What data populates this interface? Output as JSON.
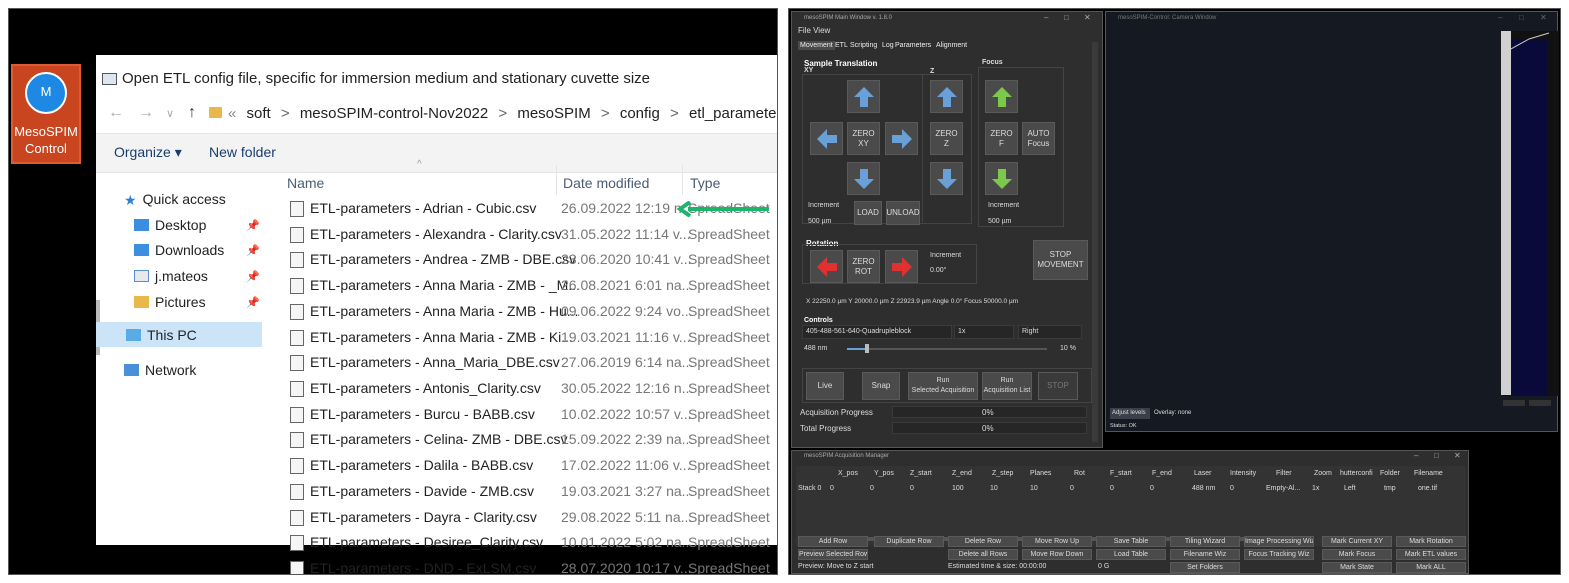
{
  "desktop_icon": {
    "letter": "M",
    "line1": "MesoSPIM",
    "line2": "Control"
  },
  "dialog": {
    "title": "Open ETL config file, specific for immersion medium and stationary cuvette size",
    "breadcrumb": [
      "«",
      "soft",
      ">",
      "mesoSPIM-control-Nov2022",
      ">",
      "mesoSPIM",
      ">",
      "config",
      ">",
      "etl_parameters"
    ],
    "organize": "Organize ▾",
    "new_folder": "New folder",
    "sidebar": {
      "quick_access": "Quick access",
      "items": [
        "Desktop",
        "Downloads",
        "j.mateos",
        "Pictures"
      ],
      "this_pc": "This PC",
      "network": "Network"
    },
    "columns": {
      "name": "Name",
      "date": "Date modified",
      "type": "Type"
    },
    "files": [
      {
        "name": "ETL-parameters - Adrian - Cubic.csv",
        "date": "26.09.2022 12:19 n...",
        "type": "SpreadSheet"
      },
      {
        "name": "ETL-parameters - Alexandra - Clarity.csv",
        "date": "31.05.2022 11:14 v...",
        "type": "SpreadSheet"
      },
      {
        "name": "ETL-parameters - Andrea - ZMB - DBE.csv",
        "date": "23.06.2020 10:41 v...",
        "type": "SpreadSheet"
      },
      {
        "name": "ETL-parameters - Anna Maria - ZMB - _M...",
        "date": "26.08.2021 6:01 na...",
        "type": "SpreadSheet"
      },
      {
        "name": "ETL-parameters - Anna Maria - ZMB - Hu...",
        "date": "09.06.2022 9:24 vo...",
        "type": "SpreadSheet"
      },
      {
        "name": "ETL-parameters - Anna Maria - ZMB - Ki...",
        "date": "19.03.2021 11:16 v...",
        "type": "SpreadSheet"
      },
      {
        "name": "ETL-parameters - Anna_Maria_DBE.csv",
        "date": "27.06.2019 6:14 na...",
        "type": "SpreadSheet"
      },
      {
        "name": "ETL-parameters - Antonis_Clarity.csv",
        "date": "30.05.2022 12:16 n...",
        "type": "SpreadSheet"
      },
      {
        "name": "ETL-parameters - Burcu - BABB.csv",
        "date": "10.02.2022 10:57 v...",
        "type": "SpreadSheet"
      },
      {
        "name": "ETL-parameters - Celina- ZMB - DBE.csv",
        "date": "15.09.2022 2:39 na...",
        "type": "SpreadSheet"
      },
      {
        "name": "ETL-parameters - Dalila - BABB.csv",
        "date": "17.02.2022 11:06 v...",
        "type": "SpreadSheet"
      },
      {
        "name": "ETL-parameters - Davide - ZMB.csv",
        "date": "19.03.2021 3:27 na...",
        "type": "SpreadSheet"
      },
      {
        "name": "ETL-parameters - Dayra - Clarity.csv",
        "date": "29.08.2022 5:11 na...",
        "type": "SpreadSheet"
      },
      {
        "name": "ETL-parameters - Desiree_Clarity.csv",
        "date": "10.01.2022 5:02 na...",
        "type": "SpreadSheet"
      },
      {
        "name": "ETL-parameters - DND - ExLSM.csv",
        "date": "28.07.2020 10:17 v...",
        "type": "SpreadSheet"
      }
    ],
    "arrow_color": "#1db56b"
  },
  "main_window": {
    "title": "mesoSPIM Main Window v. 1.8.0",
    "menu": "File View",
    "tabs": [
      "Movement",
      "ETL",
      "Scripting",
      "Log",
      "Parameters",
      "Alignment"
    ],
    "sample_translation": "Sample Translation",
    "xy": "XY",
    "z": "Z",
    "focus": "Focus",
    "zero_xy": [
      "ZERO",
      "XY"
    ],
    "zero_z": [
      "ZERO",
      "Z"
    ],
    "zero_f": [
      "ZERO",
      "F"
    ],
    "auto_focus": [
      "AUTO",
      "Focus"
    ],
    "increment": "Increment",
    "inc_xy": "500 µm",
    "inc_f": "500 µm",
    "load": "LOAD",
    "unload": "UNLOAD",
    "rotation": "Rotation",
    "zero_rot": [
      "ZERO",
      "ROT"
    ],
    "inc_rot": "0.00°",
    "stop_movement": [
      "STOP",
      "MOVEMENT"
    ],
    "position": "X  22250.0 µm   Y  20000.0 µm   Z   22923.9 µm    Angle       0.0°      Focus  50000.0 µm",
    "controls": "Controls",
    "filter": "405-488-561-640-Quadrupleblock",
    "zoom": "1x",
    "shutter": "Right",
    "laser": "488 nm",
    "intensity": "10 %",
    "live": "Live",
    "snap": "Snap",
    "run_sel": [
      "Run",
      "Selected Acquisition"
    ],
    "run_list": [
      "Run",
      "Acquisition List"
    ],
    "stop": "STOP",
    "acq_progress": "Acquisition Progress",
    "acq_pct": "0%",
    "total_progress": "Total Progress",
    "total_pct": "0%"
  },
  "camera_window": {
    "title": "mesoSPIM-Control: Camera Window",
    "adjust_levels": "Adjust levels",
    "overlay": "Overlay: none",
    "status": "Status: OK"
  },
  "acq_manager": {
    "title": "mesoSPIM Acquisition Manager",
    "headers": [
      "X_pos",
      "Y_pos",
      "Z_start",
      "Z_end",
      "Z_step",
      "Planes",
      "Rot",
      "F_start",
      "F_end",
      "Laser",
      "Intensity",
      "Filter",
      "Zoom",
      "hutterconfi",
      "Folder",
      "Filename"
    ],
    "row_label": "Stack 0",
    "row": [
      "0",
      "0",
      "0",
      "100",
      "10",
      "10",
      "0",
      "0",
      "0",
      "488 nm",
      "0",
      "Empty-Al...",
      "1x",
      "Left",
      "tmp",
      "one.tif"
    ],
    "buttons_row1": [
      "Add Row",
      "Duplicate Row",
      "Delete Row",
      "Move Row Up",
      "Save Table",
      "Tiling Wizard",
      "Image Processing Wiz",
      "Mark Current XY",
      "Mark Rotation"
    ],
    "buttons_row2": [
      "Preview Selected Row",
      "",
      "Delete all Rows",
      "Move Row Down",
      "Load Table",
      "Filename Wiz",
      "Focus Tracking Wiz",
      "Mark Focus",
      "Mark ETL values"
    ],
    "preview_label": "Preview: Move to Z start",
    "estimate_label": "Estimated time & size:  00:00:00",
    "estimate_size": "0 G",
    "set_folders": "Set Folders",
    "mark_state": "Mark State",
    "mark_all": "Mark ALL"
  }
}
